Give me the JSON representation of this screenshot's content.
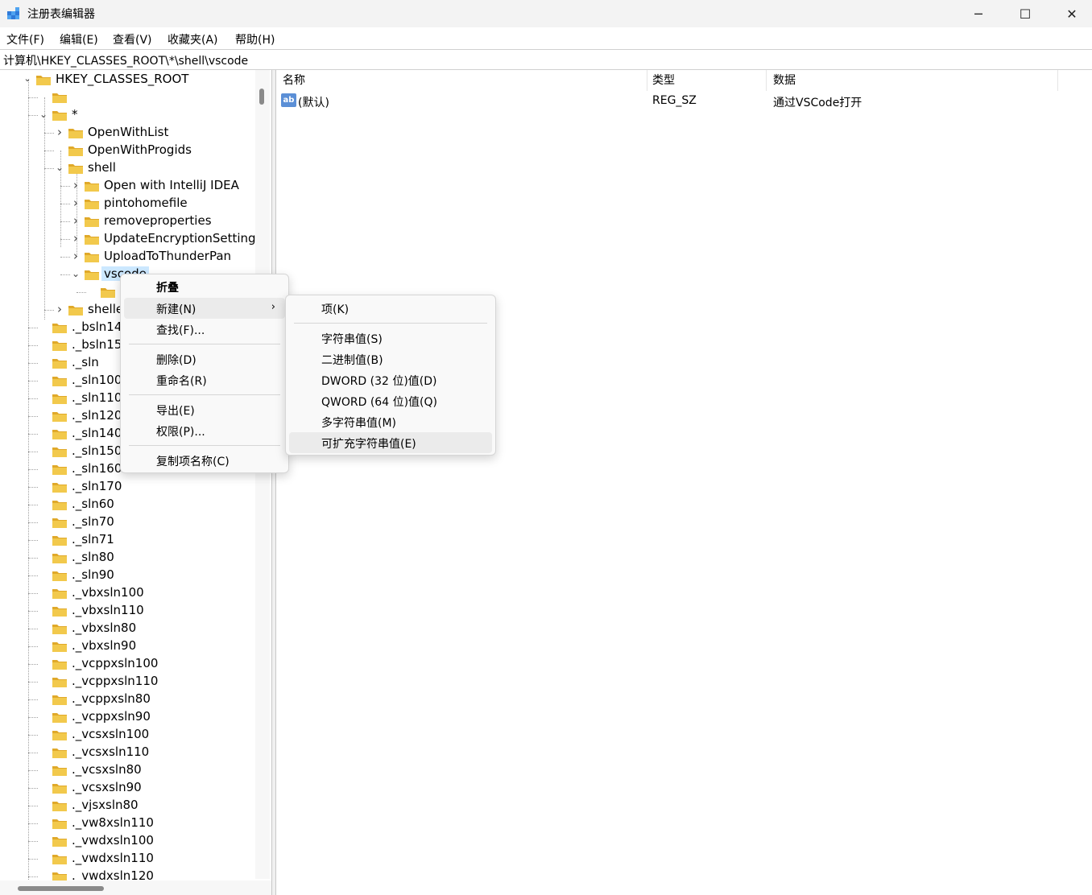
{
  "window": {
    "title": "注册表编辑器",
    "controls": [
      "─",
      "☐",
      "✕"
    ]
  },
  "menubar": [
    "文件(F)",
    "编辑(E)",
    "查看(V)",
    "收藏夹(A)",
    "帮助(H)"
  ],
  "address": "计算机\\HKEY_CLASSES_ROOT\\*\\shell\\vscode",
  "tree": {
    "root": "HKEY_CLASSES_ROOT",
    "items": [
      {
        "label": "",
        "level": 1,
        "chevron": ""
      },
      {
        "label": "*",
        "level": 1,
        "chevron": "v"
      },
      {
        "label": "OpenWithList",
        "level": 2,
        "chevron": ">"
      },
      {
        "label": "OpenWithProgids",
        "level": 2,
        "chevron": ""
      },
      {
        "label": "shell",
        "level": 2,
        "chevron": "v"
      },
      {
        "label": "Open with IntelliJ IDEA",
        "level": 3,
        "chevron": ">"
      },
      {
        "label": "pintohomefile",
        "level": 3,
        "chevron": ">"
      },
      {
        "label": "removeproperties",
        "level": 3,
        "chevron": ">"
      },
      {
        "label": "UpdateEncryptionSetting",
        "level": 3,
        "chevron": ">"
      },
      {
        "label": "UploadToThunderPan",
        "level": 3,
        "chevron": ">"
      },
      {
        "label": "vscode",
        "level": 3,
        "chevron": "v",
        "selected": true
      },
      {
        "label": "",
        "level": 4,
        "chevron": ""
      },
      {
        "label": "shellex",
        "level": 2,
        "chevron": ">"
      },
      {
        "label": "._bsln14",
        "level": 1,
        "chevron": ""
      },
      {
        "label": "._bsln15",
        "level": 1,
        "chevron": ""
      },
      {
        "label": "._sln",
        "level": 1,
        "chevron": ""
      },
      {
        "label": "._sln100",
        "level": 1,
        "chevron": ""
      },
      {
        "label": "._sln110",
        "level": 1,
        "chevron": ""
      },
      {
        "label": "._sln120",
        "level": 1,
        "chevron": ""
      },
      {
        "label": "._sln140",
        "level": 1,
        "chevron": ""
      },
      {
        "label": "._sln150",
        "level": 1,
        "chevron": ""
      },
      {
        "label": "._sln160",
        "level": 1,
        "chevron": ""
      },
      {
        "label": "._sln170",
        "level": 1,
        "chevron": ""
      },
      {
        "label": "._sln60",
        "level": 1,
        "chevron": ""
      },
      {
        "label": "._sln70",
        "level": 1,
        "chevron": ""
      },
      {
        "label": "._sln71",
        "level": 1,
        "chevron": ""
      },
      {
        "label": "._sln80",
        "level": 1,
        "chevron": ""
      },
      {
        "label": "._sln90",
        "level": 1,
        "chevron": ""
      },
      {
        "label": "._vbxsln100",
        "level": 1,
        "chevron": ""
      },
      {
        "label": "._vbxsln110",
        "level": 1,
        "chevron": ""
      },
      {
        "label": "._vbxsln80",
        "level": 1,
        "chevron": ""
      },
      {
        "label": "._vbxsln90",
        "level": 1,
        "chevron": ""
      },
      {
        "label": "._vcppxsln100",
        "level": 1,
        "chevron": ""
      },
      {
        "label": "._vcppxsln110",
        "level": 1,
        "chevron": ""
      },
      {
        "label": "._vcppxsln80",
        "level": 1,
        "chevron": ""
      },
      {
        "label": "._vcppxsln90",
        "level": 1,
        "chevron": ""
      },
      {
        "label": "._vcsxsln100",
        "level": 1,
        "chevron": ""
      },
      {
        "label": "._vcsxsln110",
        "level": 1,
        "chevron": ""
      },
      {
        "label": "._vcsxsln80",
        "level": 1,
        "chevron": ""
      },
      {
        "label": "._vcsxsln90",
        "level": 1,
        "chevron": ""
      },
      {
        "label": "._vjsxsln80",
        "level": 1,
        "chevron": ""
      },
      {
        "label": "._vw8xsln110",
        "level": 1,
        "chevron": ""
      },
      {
        "label": "._vwdxsln100",
        "level": 1,
        "chevron": ""
      },
      {
        "label": "._vwdxsln110",
        "level": 1,
        "chevron": ""
      },
      {
        "label": "._vwdxsln120",
        "level": 1,
        "chevron": ""
      }
    ]
  },
  "list": {
    "columns": [
      "名称",
      "类型",
      "数据"
    ],
    "rows": [
      {
        "name": "(默认)",
        "type": "REG_SZ",
        "data": "通过VSCode打开",
        "icon": "ab"
      }
    ]
  },
  "context_menu": {
    "items": [
      {
        "label": "折叠",
        "bold": true
      },
      {
        "label": "新建(N)",
        "submenu": true,
        "highlighted": true
      },
      {
        "label": "查找(F)..."
      },
      {
        "separator": true
      },
      {
        "label": "删除(D)"
      },
      {
        "label": "重命名(R)"
      },
      {
        "separator": true
      },
      {
        "label": "导出(E)"
      },
      {
        "label": "权限(P)..."
      },
      {
        "separator": true
      },
      {
        "label": "复制项名称(C)"
      }
    ]
  },
  "submenu": {
    "items": [
      {
        "label": "项(K)"
      },
      {
        "separator": true
      },
      {
        "label": "字符串值(S)"
      },
      {
        "label": "二进制值(B)"
      },
      {
        "label": "DWORD (32 位)值(D)"
      },
      {
        "label": "QWORD (64 位)值(Q)"
      },
      {
        "label": "多字符串值(M)"
      },
      {
        "label": "可扩充字符串值(E)",
        "highlighted": true
      }
    ]
  },
  "colors": {
    "folder": "#f2c94c",
    "folder_dark": "#e0a92a",
    "selection": "#cce8ff",
    "menu_highlight": "#ebebeb"
  }
}
